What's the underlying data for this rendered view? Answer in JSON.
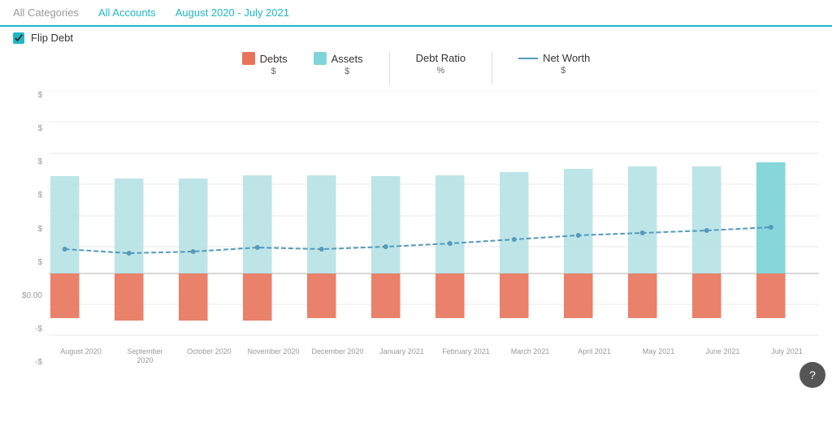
{
  "topBar": {
    "items": [
      {
        "label": "All Categories",
        "active": false
      },
      {
        "label": "All Accounts",
        "active": true
      },
      {
        "label": "August 2020 - July 2021",
        "active": true
      }
    ]
  },
  "flipDebt": {
    "label": "Flip Debt",
    "checked": true
  },
  "legend": {
    "items": [
      {
        "label": "Debts",
        "unit": "$",
        "color": "#e8735a",
        "type": "box"
      },
      {
        "label": "Assets",
        "unit": "$",
        "color": "#7fd4d8",
        "type": "box"
      },
      {
        "label": "Debt Ratio",
        "unit": "%",
        "color": null,
        "type": "separator"
      },
      {
        "label": "Net Worth",
        "unit": "$",
        "color": "#5599bb",
        "type": "line"
      }
    ]
  },
  "yAxis": {
    "labels": [
      "$",
      "$",
      "$",
      "$",
      "$",
      "$",
      "$0.00",
      "-$",
      "-$"
    ]
  },
  "xAxis": {
    "labels": [
      "August 2020",
      "September 2020",
      "October 2020",
      "November 2020",
      "December 2020",
      "January 2021",
      "February 2021",
      "March 2021",
      "April 2021",
      "May 2021",
      "June 2021",
      "July 2021"
    ]
  },
  "chart": {
    "assetHeights": [
      62,
      60,
      60,
      63,
      63,
      62,
      63,
      66,
      68,
      70,
      70,
      74
    ],
    "debtHeights": [
      28,
      29,
      29,
      29,
      28,
      28,
      28,
      28,
      28,
      28,
      28,
      28
    ],
    "netWorthY": [
      195,
      198,
      196,
      192,
      193,
      190,
      188,
      184,
      180,
      178,
      175,
      170
    ]
  },
  "help": {
    "label": "?"
  }
}
